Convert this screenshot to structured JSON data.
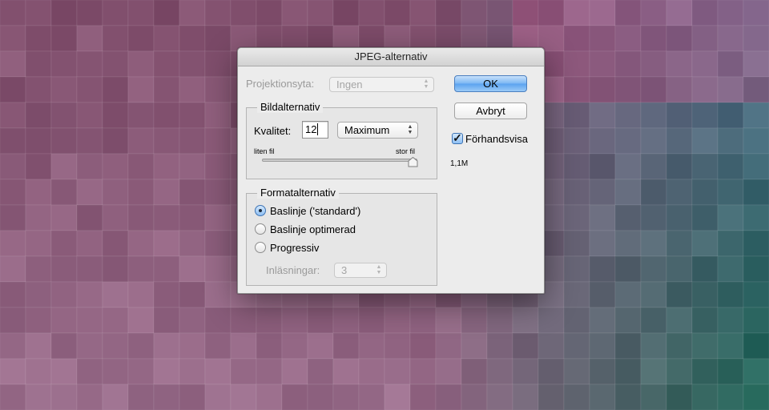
{
  "dialog": {
    "title": "JPEG-alternativ",
    "matte": {
      "label": "Projektionsyta:",
      "value": "Ingen"
    },
    "ok_label": "OK",
    "cancel_label": "Avbryt",
    "preview": {
      "label": "Förhandsvisa",
      "checked": true
    },
    "file_size": "1,1M",
    "image_options": {
      "title": "Bildalternativ",
      "quality_label": "Kvalitet:",
      "quality_value": "12",
      "quality_preset": "Maximum",
      "slider_min_label": "liten fil",
      "slider_max_label": "stor fil",
      "slider_fraction": 1.0
    },
    "format_options": {
      "title": "Formatalternativ",
      "options": [
        {
          "label": "Baslinje ('standard')",
          "selected": true
        },
        {
          "label": "Baslinje optimerad",
          "selected": false
        },
        {
          "label": "Progressiv",
          "selected": false
        }
      ],
      "scans_label": "Inläsningar:",
      "scans_value": "3"
    }
  },
  "icons": {
    "popup_arrows": "up-down-arrows-icon",
    "checkmark": "checkmark-icon",
    "slider_thumb": "slider-thumb-icon"
  },
  "colors": {
    "ok_button": "#7ab6f3",
    "background_left": "#8a5c78",
    "background_right": "#1e6a4a"
  }
}
